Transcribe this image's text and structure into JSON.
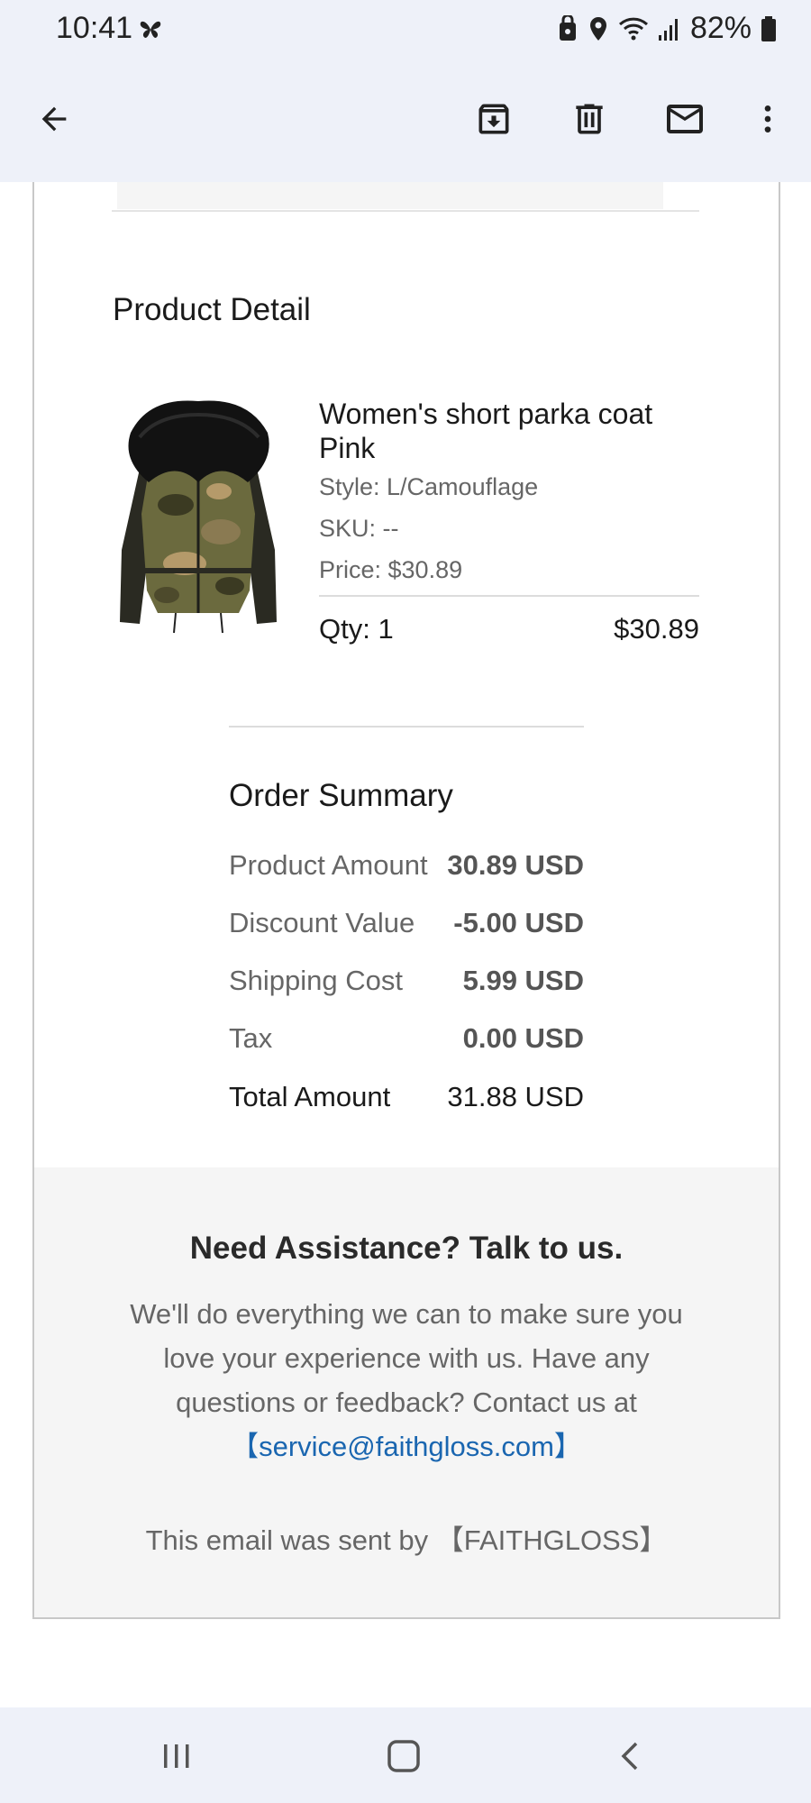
{
  "status_bar": {
    "time": "10:41",
    "battery": "82%"
  },
  "app_bar": {
    "icons": [
      "back-arrow-icon",
      "archive-icon",
      "delete-icon",
      "mark-unread-icon",
      "more-vert-icon"
    ]
  },
  "product_detail": {
    "heading": "Product Detail",
    "item": {
      "name": "Women's short parka coat Pink",
      "style": "Style: L/Camouflage",
      "sku": "SKU: --",
      "price": "Price: $30.89",
      "qty": "Qty: 1",
      "line_total": "$30.89"
    }
  },
  "order_summary": {
    "heading": "Order Summary",
    "rows": [
      {
        "label": "Product Amount",
        "value": "30.89 USD"
      },
      {
        "label": "Discount Value",
        "value": "-5.00 USD"
      },
      {
        "label": "Shipping Cost",
        "value": "5.99 USD"
      },
      {
        "label": "Tax",
        "value": "0.00 USD"
      },
      {
        "label": "Total Amount",
        "value": "31.88 USD"
      }
    ]
  },
  "assistance": {
    "title": "Need Assistance? Talk to us.",
    "body": "We'll do everything we can to make sure you love your experience with us. Have any questions or feedback? Contact us at",
    "email_link": "【service@faithgloss.com】",
    "sent_by": "This email was sent by 【FAITHGLOSS】"
  },
  "colors": {
    "system_bar_bg": "#eef1f9",
    "link": "#1a66b0",
    "footer_bg": "#f5f5f5",
    "card_border": "#c8c8c8"
  }
}
